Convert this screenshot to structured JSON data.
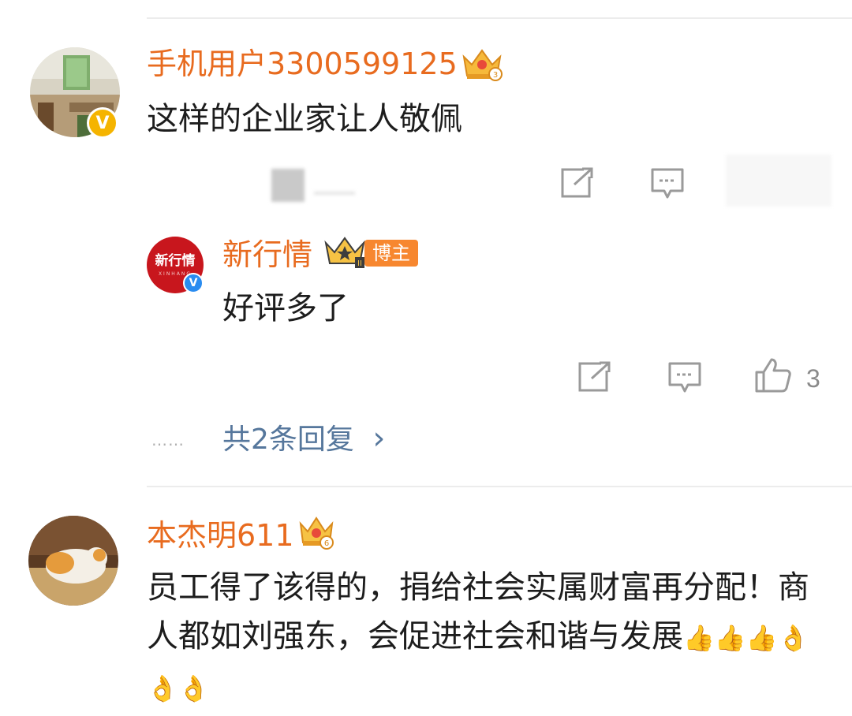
{
  "comments": [
    {
      "username": "手机用户3300599125",
      "text": "这样的企业家让人敬佩",
      "verified_badge": "v-badge-icon",
      "level_icon": "crown-level-icon"
    },
    {
      "username": "本杰明611",
      "text": "员工得了该得的，捐给社会实属财富再分配！商人都如刘强东，会促进社会和谐与发展",
      "emojis": "👍👍👍👌👌👌",
      "level_icon": "crown-level-icon"
    }
  ],
  "reply": {
    "username": "新行情",
    "avatar_text": "新行情",
    "avatar_subtext": "XINHANG",
    "blogger_tag": "博主",
    "text": "好评多了",
    "like_count": "3",
    "level_icon": "crown-level-icon"
  },
  "more_replies": {
    "dots": "……",
    "label": "共2条回复",
    "chevron": "›"
  },
  "colors": {
    "username": "#e86b1f",
    "link": "#56779c",
    "avatar_red": "#c8161d",
    "blogger_tag": "#f7872f"
  }
}
